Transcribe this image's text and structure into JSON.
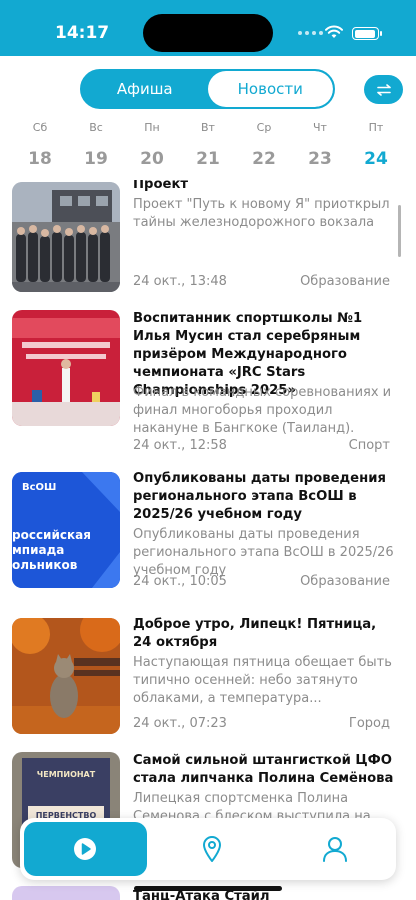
{
  "status_bar": {
    "time": "14:17"
  },
  "tabs": {
    "afisha": "Афиша",
    "news": "Новости"
  },
  "calendar": [
    {
      "weekday": "Сб",
      "day": "18"
    },
    {
      "weekday": "Вс",
      "day": "19"
    },
    {
      "weekday": "Пн",
      "day": "20"
    },
    {
      "weekday": "Вт",
      "day": "21"
    },
    {
      "weekday": "Ср",
      "day": "22"
    },
    {
      "weekday": "Чт",
      "day": "23"
    },
    {
      "weekday": "Пт",
      "day": "24"
    }
  ],
  "calendar_selected": "24",
  "news": [
    {
      "title": "Проект",
      "description": "Проект \"Путь к новому Я\" приоткрыл тайны железнодорожного вокзала",
      "date": "24 окт., 13:48",
      "category": "Образование"
    },
    {
      "title": "Воспитанник спортшколы №1 Илья Мусин стал серебряным призёром Международного чемпионата «JRC Stars Championships 2025»",
      "description": "Финал в командных соревнованиях и финал многоборья проходил накануне в Бангкоке (Таиланд).",
      "date": "24 окт., 12:58",
      "category": "Спорт"
    },
    {
      "title": "Опубликованы даты проведения регионального этапа ВсОШ в 2025/26 учебном году",
      "description": "Опубликованы даты проведения регионального этапа ВсОШ в 2025/26 учебном году",
      "date": "24 окт., 10:05",
      "category": "Образование",
      "thumb_text": "ВсОШ",
      "thumb_caption": "российская мпиада ольников"
    },
    {
      "title": "Доброе утро, Липецк! Пятница, 24 октября",
      "description": "Наступающая пятница обещает быть типично осенней: небо затянуто облаками, а температура...",
      "date": "24 окт., 07:23",
      "category": "Город"
    },
    {
      "title": "Самой сильной штангисткой ЦФО стала липчанка Полина Семёнова",
      "description": "Липецкая спортсменка Полина Семенова с блеском выступила на",
      "thumb_text": "ЧЕМПИОНАТ",
      "thumb_caption": "ПЕРВЕНСТВО"
    },
    {
      "title": "Танц-Атака Стайл"
    }
  ],
  "colors": {
    "accent": "#12a9d1",
    "muted": "#8c8c8c"
  },
  "nav": {
    "items": [
      "play-icon",
      "location-pin-icon",
      "profile-icon"
    ],
    "active": "play-icon"
  }
}
